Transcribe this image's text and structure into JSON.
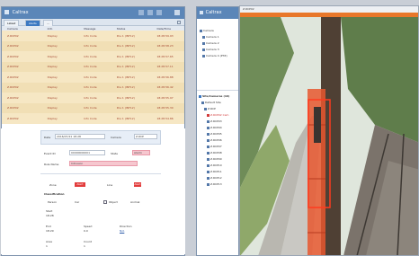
{
  "left_window": {
    "title": "Caltrax",
    "tabs": [
      "Latest",
      "Alerts",
      "..."
    ],
    "columns": [
      "Camera",
      "Info",
      "Message",
      "Status",
      "Date/Time"
    ],
    "rows": [
      [
        "Z.RCP02",
        "Display",
        "Info Code",
        "Pos 1 (INT12)",
        "18:28:59.93"
      ],
      [
        "Z.RCP02",
        "Display",
        "Info Code",
        "Pos 1 (INT12)",
        "18:28:58.23"
      ],
      [
        "Z.RCP02",
        "Display",
        "Info Code",
        "Pos 1 (INT12)",
        "18:28:57.65"
      ],
      [
        "Z.RCP02",
        "Display",
        "Info Code",
        "Pos 1 (INT12)",
        "18:28:57.11"
      ],
      [
        "Z.RCP02",
        "Display",
        "Info Code",
        "Pos 1 (INT12)",
        "18:28:56.88"
      ],
      [
        "Z.RCP02",
        "Display",
        "Info Code",
        "Pos 1 (INT12)",
        "18:28:56.42"
      ],
      [
        "Z.RCP02",
        "Display",
        "Info Code",
        "Pos 1 (INT12)",
        "18:28:55.97"
      ],
      [
        "Z.RCP02",
        "Display",
        "Info Code",
        "Pos 1 (INT12)",
        "18:28:55.30"
      ],
      [
        "Z.RCP02",
        "Display",
        "Info Code",
        "Pos 1 (INT12)",
        "18:28:54.86"
      ]
    ],
    "form": {
      "date_label": "Date",
      "date_value": "2016/07/21 18:28",
      "camera_label": "Camera",
      "camera_value": "Z.RCP",
      "event_label": "Event ID",
      "event_value": "00000000001",
      "state_label": "State",
      "state_value": "Alarm",
      "rule_label": "Rule Name",
      "rule_value": "Intrusion",
      "lbl_a": "Zone",
      "btn_a": "Alert",
      "lbl_b": "Line",
      "btn_b": "Alert",
      "section": "Classification",
      "c1": "Person",
      "c2": "Car",
      "c3": "Object",
      "c4": "Animal",
      "d1_label": "Start",
      "d1_value": "18:28",
      "d2_label": "End",
      "d2_value": "18:29",
      "d3_label": "Speed",
      "d3_value": "0.0",
      "d4_label": "Direction",
      "d4_value": "N/A",
      "d5_label": "Area",
      "d5_value": "1",
      "d6_label": "Count",
      "d6_value": "1"
    }
  },
  "middle_window": {
    "title": "Caltrax",
    "top_items": [
      "Camera",
      "Camera 1",
      "Camera 2",
      "Camera 3",
      "Camera 4 (PTZ)"
    ],
    "group_title": "Site/Cameras (16)",
    "group_sub": "Default Site",
    "group_sub2": "Z.RCP",
    "children": [
      "Z.RCP02 Cam",
      "Z.RCP03",
      "Z.RCP04",
      "Z.RCP05",
      "Z.RCP06",
      "Z.RCP07",
      "Z.RCP08",
      "Z.RCP09",
      "Z.RCP10",
      "Z.RCP11",
      "Z.RCP12",
      "Z.RCP13"
    ]
  },
  "right_window": {
    "title": "Z.RCP02"
  },
  "colors": {
    "accent": "#3d79c2",
    "title_bar": "#5b86b8",
    "row_bg": "#f6e7c4",
    "alert_text": "#a5452f",
    "detection_box": "#e8402a",
    "camera_header": "#e8772a"
  }
}
